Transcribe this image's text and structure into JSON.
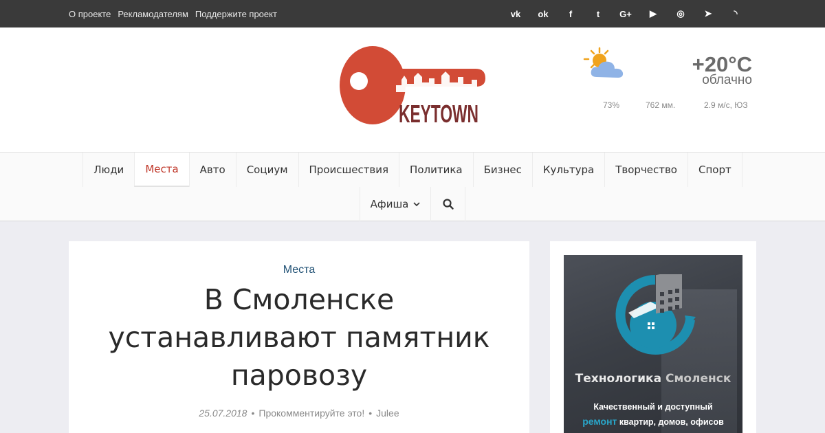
{
  "topbar": {
    "links": [
      "О проекте",
      "Рекламодателям",
      "Поддержите проект"
    ],
    "social": [
      {
        "icon": "vk-icon",
        "glyph": "vk"
      },
      {
        "icon": "odnoklassniki-icon",
        "glyph": "ok"
      },
      {
        "icon": "facebook-icon",
        "glyph": "f"
      },
      {
        "icon": "twitter-icon",
        "glyph": "t"
      },
      {
        "icon": "google-plus-icon",
        "glyph": "G+"
      },
      {
        "icon": "youtube-icon",
        "glyph": "▶"
      },
      {
        "icon": "instagram-icon",
        "glyph": "◎"
      },
      {
        "icon": "telegram-icon",
        "glyph": "➤"
      },
      {
        "icon": "rss-icon",
        "glyph": "◝"
      }
    ]
  },
  "header": {
    "logo_text": "KEYTOWN",
    "weather": {
      "icon": "partly-cloudy-icon",
      "temperature": "+20°C",
      "condition": "облачно",
      "humidity": "73%",
      "pressure": "762 мм.",
      "wind": "2.9 м/с, ЮЗ"
    }
  },
  "nav": {
    "row1": [
      "Люди",
      "Места",
      "Авто",
      "Социум",
      "Происшествия",
      "Политика",
      "Бизнес",
      "Культура",
      "Творчество",
      "Спорт"
    ],
    "active": "Места",
    "row2_dropdown": "Афиша",
    "search_icon": "search-icon"
  },
  "article": {
    "category": "Места",
    "title": "В Смоленске устанавливают памятник паровозу",
    "date": "25.07.2018",
    "comments": "Прокомментируйте это!",
    "author": "Julee",
    "separator": "•"
  },
  "sidebar": {
    "ad": {
      "name_part1": "Технологика",
      "name_part2": "Смоленск",
      "line1": "Качественный и доступный",
      "line2_highlight": "ремонт",
      "line2_rest": "квартир, домов, офисов"
    }
  },
  "colors": {
    "topbar": "#3a3a3a",
    "accent_red": "#c0392b",
    "logo_red": "#d24b36",
    "logo_brown": "#7a2e2e",
    "category_blue": "#1e4f73",
    "ad_blue": "#29a6c9"
  }
}
